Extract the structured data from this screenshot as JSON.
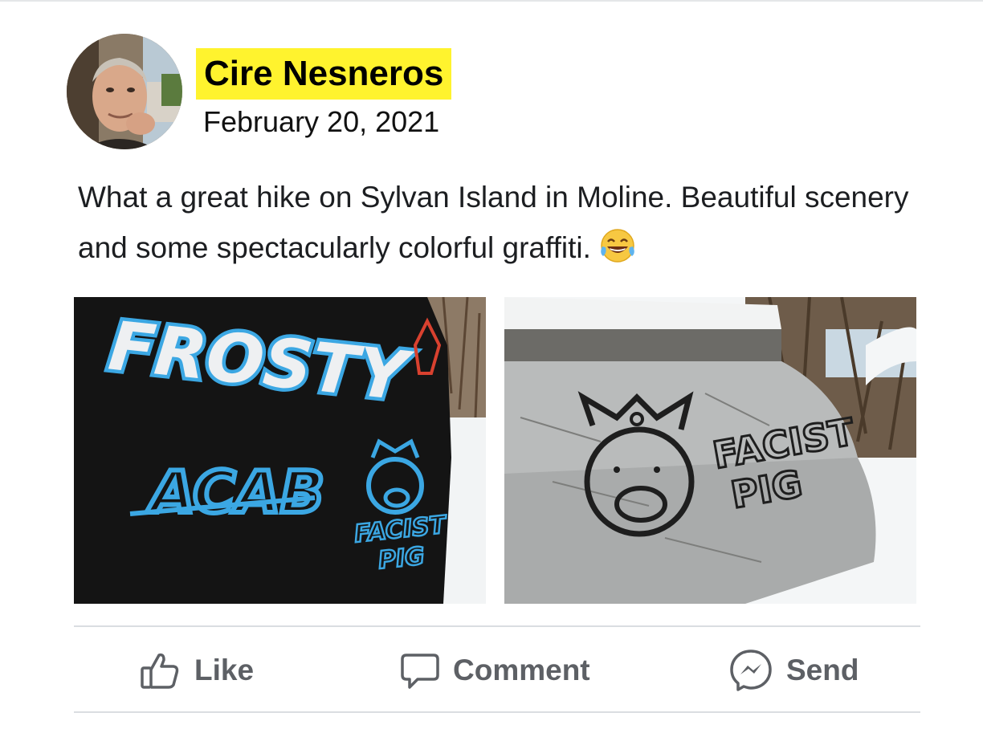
{
  "post": {
    "author_name": "Cire Nesneros",
    "date": "February 20, 2021",
    "text": "What a great hike on Sylvan Island in Moline. Beautiful scenery and some spectacularly colorful graffiti.",
    "emoji": "tears-of-joy-emoji",
    "highlight_color": "#fff32e"
  },
  "photos": [
    {
      "graffiti": [
        "FROSTY",
        "ACAB",
        "FACIST",
        "PIG"
      ],
      "paint_color": "#3ba7e3",
      "rock_color": "#141414"
    },
    {
      "graffiti": [
        "FACIST",
        "PIG"
      ],
      "paint_color": "#1e1e1e",
      "rock_color": "#a9abab"
    }
  ],
  "actions": {
    "like_label": "Like",
    "comment_label": "Comment",
    "send_label": "Send",
    "like_icon": "thumbs-up-icon",
    "comment_icon": "speech-bubble-icon",
    "send_icon": "messenger-icon",
    "text_color": "#5d6065"
  }
}
